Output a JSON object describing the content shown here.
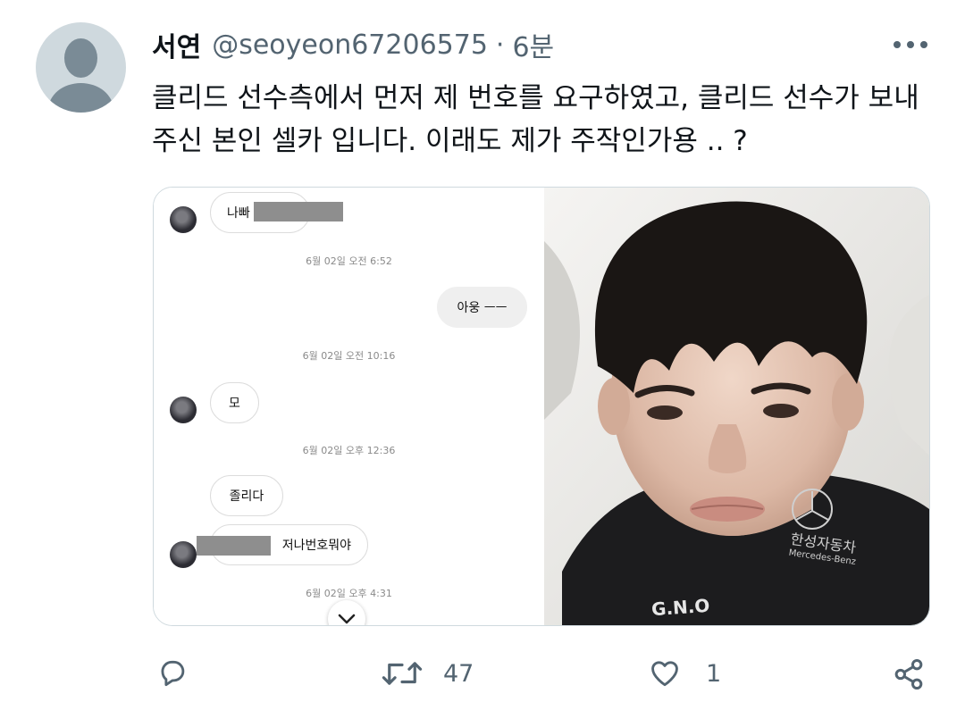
{
  "author": {
    "name": "서연",
    "handle": "@seoyeon67206575",
    "separator": "·",
    "time": "6분"
  },
  "tweet": {
    "text": "클리드 선수측에서 먼저 제 번호를 요구하였고, 클리드 선수가 보내주신 본인 셀카 입니다. 이래도 제가 주작인가용 .. ?"
  },
  "media": {
    "chat": {
      "messages": [
        {
          "text": "나빠",
          "redacted": true
        },
        {
          "timestamp": "6월 02일 오전 6:52"
        },
        {
          "text": "아웅 ㅡㅡ",
          "mine": true
        },
        {
          "timestamp": "6월 02일 오전 10:16"
        },
        {
          "text": "모"
        },
        {
          "timestamp": "6월 02일 오후 12:36"
        },
        {
          "text": "졸리다"
        },
        {
          "text": "저나번호뭐야",
          "redacted": true
        },
        {
          "timestamp": "6월 02일 오후 4:31"
        }
      ]
    },
    "photo": {
      "description": "selfie photo",
      "shirt_text": "한성자동차",
      "shirt_text2": "Mercedes-Benz",
      "shirt_text3": "G.N.O"
    }
  },
  "actions": {
    "reply_count": "",
    "retweet_count": "47",
    "like_count": "1",
    "icons": [
      "reply-icon",
      "retweet-icon",
      "like-icon",
      "share-icon"
    ]
  },
  "colors": {
    "text": "#0f1419",
    "secondary": "#536471",
    "border": "#cfd9de"
  }
}
